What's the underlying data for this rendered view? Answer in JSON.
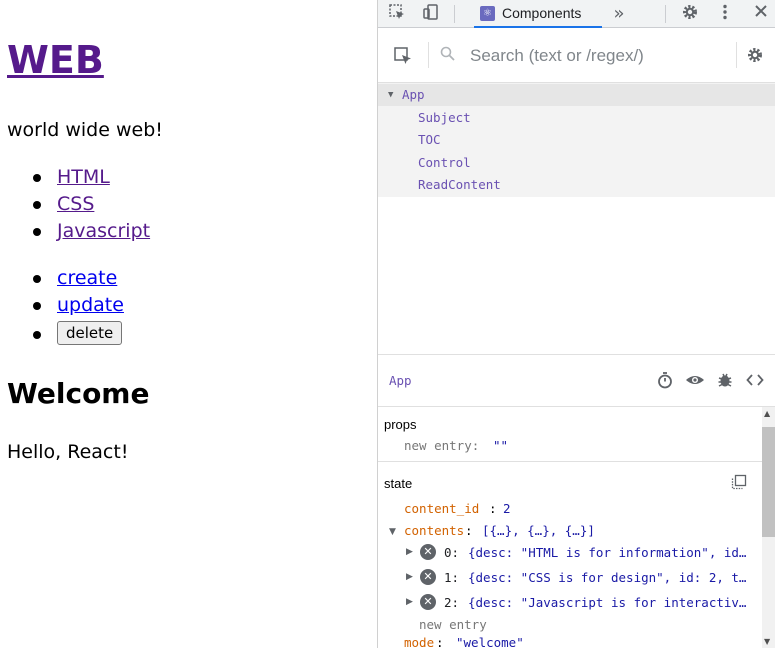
{
  "page": {
    "title": "WEB",
    "description": "world wide web!",
    "nav": [
      "HTML",
      "CSS",
      "Javascript"
    ],
    "controls": {
      "create": "create",
      "update": "update",
      "delete": "delete"
    },
    "heading": "Welcome",
    "body": "Hello, React!"
  },
  "devtools": {
    "tab_label": "Components",
    "search_placeholder": "Search (text or /regex/)",
    "tree": {
      "root": "App",
      "children": [
        "Subject",
        "TOC",
        "Control",
        "ReadContent"
      ]
    },
    "selected_component": "App",
    "props": {
      "title": "props",
      "new_entry": "new entry:",
      "new_entry_value": "\"\""
    },
    "state": {
      "title": "state",
      "content_id_key": "content_id",
      "content_id_value": "2",
      "contents_key": "contents",
      "contents_value": "[{…}, {…}, {…}]",
      "items": [
        {
          "index": "0:",
          "value": "{desc: \"HTML is for information\", id…"
        },
        {
          "index": "1:",
          "value": "{desc: \"CSS is for design\", id: 2, t…"
        },
        {
          "index": "2:",
          "value": "{desc: \"Javascript is for interactiv…"
        }
      ],
      "new_entry": "new entry",
      "mode_key": "mode",
      "mode_value": "\"welcome\""
    }
  }
}
